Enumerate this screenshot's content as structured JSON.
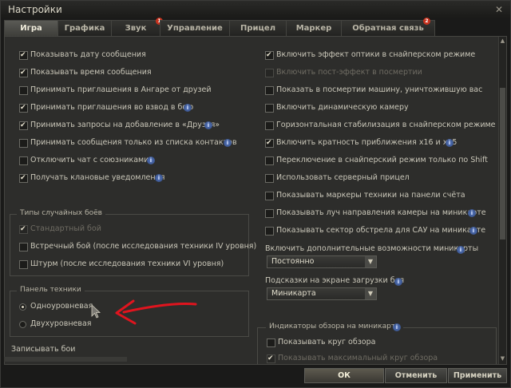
{
  "window": {
    "title": "Настройки",
    "close_glyph": "✕"
  },
  "tabs": [
    {
      "label": "Игра",
      "active": true
    },
    {
      "label": "Графика"
    },
    {
      "label": "Звук",
      "badge": "1"
    },
    {
      "label": "Управление"
    },
    {
      "label": "Прицел"
    },
    {
      "label": "Маркер"
    },
    {
      "label": "Обратная связь",
      "badge": "2"
    }
  ],
  "left_checks": [
    {
      "label": "Показывать дату сообщения",
      "checked": true,
      "info": false
    },
    {
      "label": "Показывать время сообщения",
      "checked": true,
      "info": false
    },
    {
      "label": "Принимать приглашения в Ангаре от друзей",
      "checked": false,
      "info": false
    },
    {
      "label": "Принимать приглашения во взвод в бою",
      "checked": true,
      "info": true
    },
    {
      "label": "Принимать запросы на добавление в «Друзья»",
      "checked": true,
      "info": true
    },
    {
      "label": "Принимать сообщения только из списка контактов",
      "checked": false,
      "info": true
    },
    {
      "label": "Отключить чат с союзниками",
      "checked": false,
      "info": true
    },
    {
      "label": "Получать клановые уведомления",
      "checked": true,
      "info": true
    }
  ],
  "battle_types": {
    "title": "Типы случайных боёв",
    "items": [
      {
        "label": "Стандартный бой",
        "checked": true,
        "disabled": true
      },
      {
        "label": "Встречный бой (после исследования техники IV уровня)",
        "checked": false,
        "disabled": false
      },
      {
        "label": "Штурм (после исследования техники VI уровня)",
        "checked": false,
        "disabled": false
      }
    ]
  },
  "vehicle_panel": {
    "title": "Панель техники",
    "options": [
      {
        "label": "Одноуровневая",
        "selected": true
      },
      {
        "label": "Двухуровневая",
        "selected": false
      }
    ]
  },
  "record_battles": {
    "label": "Записывать бои"
  },
  "right_checks": [
    {
      "label": "Включить эффект оптики в снайперском режиме",
      "checked": true,
      "disabled": false,
      "info": false
    },
    {
      "label": "Включить пост-эффект в посмертии",
      "checked": false,
      "disabled": true,
      "info": false
    },
    {
      "label": "Показать в посмертии машину, уничтожившую вас",
      "checked": false,
      "disabled": false,
      "info": false
    },
    {
      "label": "Включить динамическую камеру",
      "checked": false,
      "disabled": false,
      "info": false
    },
    {
      "label": "Горизонтальная стабилизация в снайперском режиме",
      "checked": false,
      "disabled": false,
      "info": false
    },
    {
      "label": "Включить кратность приближения x16 и x25",
      "checked": true,
      "disabled": false,
      "info": true
    },
    {
      "label": "Переключение в снайперский режим только по Shift",
      "checked": false,
      "disabled": false,
      "info": false
    },
    {
      "label": "Использовать серверный прицел",
      "checked": false,
      "disabled": false,
      "info": false
    },
    {
      "label": "Показывать маркеры техники на панели счёта",
      "checked": false,
      "disabled": false,
      "info": false
    },
    {
      "label": "Показывать луч направления камеры на миникарте",
      "checked": false,
      "disabled": false,
      "info": true
    },
    {
      "label": "Показывать сектор обстрела для САУ на миникарте",
      "checked": false,
      "disabled": false,
      "info": true
    }
  ],
  "minimap_extra": {
    "label": "Включить дополнительные возможности миникарты",
    "value": "Постоянно"
  },
  "loading_hints": {
    "label": "Подсказки на экране загрузки боя",
    "value": "Миникарта"
  },
  "minimap_indicators": {
    "title": "Индикаторы обзора на миникарте",
    "items": [
      {
        "label": "Показывать круг обзора",
        "checked": false,
        "disabled": false
      },
      {
        "label": "Показывать максимальный круг обзора",
        "checked": true,
        "disabled": true
      }
    ]
  },
  "buttons": {
    "ok": "ОК",
    "cancel": "Отменить",
    "apply": "Применить"
  },
  "info_glyph": "i",
  "arrow_glyph": "▼",
  "colors": {
    "annotation_arrow": "#e0141e",
    "badge": "#c8321e"
  }
}
